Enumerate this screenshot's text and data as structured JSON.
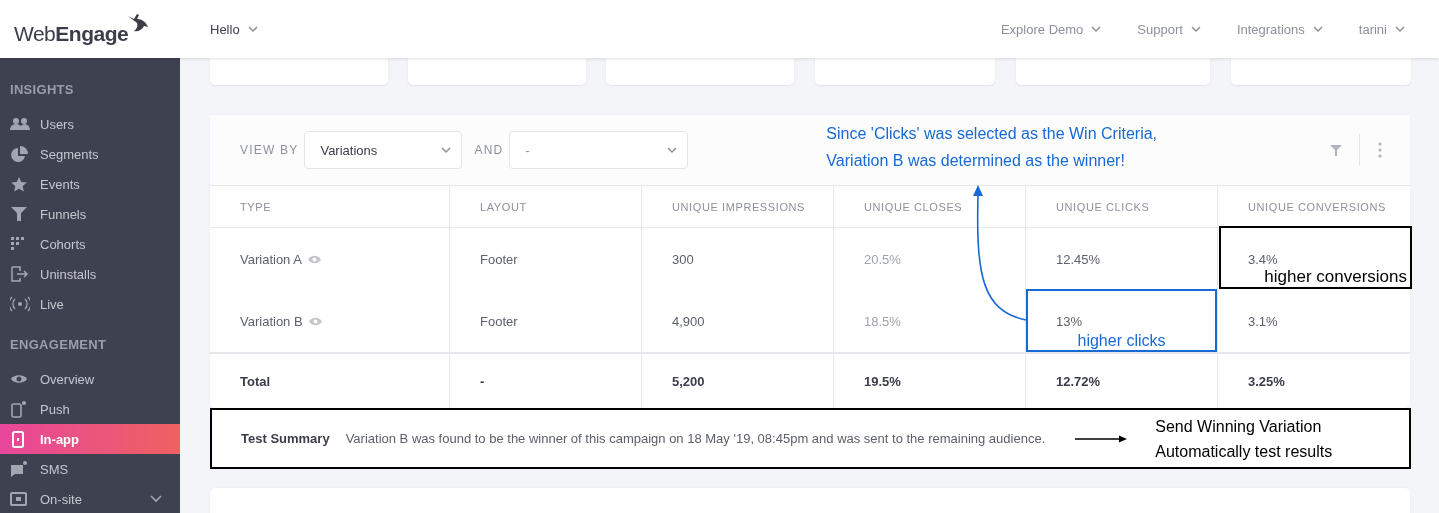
{
  "header": {
    "logo": "Web**Engage**",
    "workspace": "Hello",
    "nav": [
      "Explore Demo",
      "Support",
      "Integrations",
      "tarini"
    ]
  },
  "sidebar": {
    "sections": [
      {
        "title": "INSIGHTS",
        "items": [
          {
            "label": "Users",
            "kind": "link",
            "selected": false
          },
          {
            "label": "Segments",
            "kind": "link",
            "selected": false
          },
          {
            "label": "Events",
            "kind": "link",
            "selected": false
          },
          {
            "label": "Funnels",
            "kind": "link",
            "selected": false
          },
          {
            "label": "Cohorts",
            "kind": "link",
            "selected": false
          },
          {
            "label": "Uninstalls",
            "kind": "link",
            "selected": false
          },
          {
            "label": "Live",
            "kind": "link",
            "selected": false
          }
        ]
      },
      {
        "title": "ENGAGEMENT",
        "items": [
          {
            "label": "Overview",
            "kind": "link",
            "selected": false
          },
          {
            "label": "Push",
            "kind": "link",
            "selected": false
          },
          {
            "label": "In-app",
            "kind": "link",
            "selected": true
          },
          {
            "label": "SMS",
            "kind": "link",
            "selected": false
          },
          {
            "label": "On-site",
            "kind": "group",
            "selected": false
          }
        ]
      }
    ]
  },
  "panel": {
    "view_by_label": "VIEW BY",
    "view_by_value": "Variations",
    "and_label": "AND",
    "and_value": "-",
    "table": {
      "columns": [
        "TYPE",
        "LAYOUT",
        "UNIQUE IMPRESSIONS",
        "UNIQUE CLOSES",
        "UNIQUE CLICKS",
        "UNIQUE CONVERSIONS"
      ],
      "rows": [
        {
          "kind": "variation",
          "cells": [
            "Variation A",
            "Footer",
            "300",
            "20.5%",
            "12.45%",
            "3.4%"
          ]
        },
        {
          "kind": "variation",
          "cells": [
            "Variation B",
            "Footer",
            "4,900",
            "18.5%",
            "13%",
            "3.1%"
          ]
        },
        {
          "kind": "total",
          "cells": [
            "Total",
            "-",
            "5,200",
            "19.5%",
            "12.72%",
            "3.25%"
          ]
        }
      ]
    }
  },
  "test_summary": {
    "label": "Test Summary",
    "text": "Variation B was found to be the winner of this campaign on 18 May '19, 08:45pm and was sent to the remaining audience."
  },
  "annotations": {
    "win_note": "Since 'Clicks' was selected as the Win Criteria, Variation B was determined as the winner!",
    "clicks_label": "higher clicks",
    "conversions_label": "higher conversions",
    "send_note": "Send Winning Variation Automatically test results"
  }
}
